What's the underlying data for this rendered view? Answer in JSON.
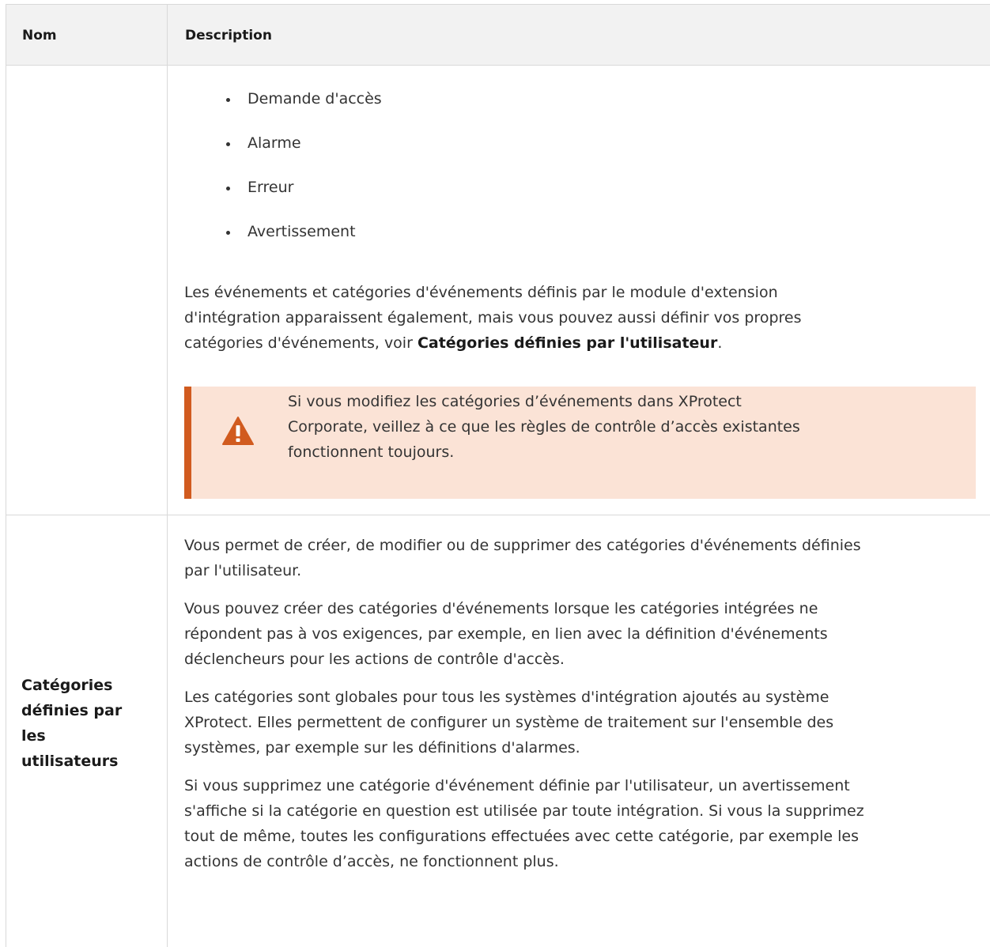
{
  "table": {
    "headers": {
      "name": "Nom",
      "description": "Description"
    },
    "row1": {
      "bullets": [
        "Demande d'accès",
        "Alarme",
        "Erreur",
        "Avertissement"
      ],
      "paragraph_part1": "Les événements et catégories d'événements définis par le module d'extension",
      "paragraph_part2": "d'intégration apparaissent également, mais vous pouvez aussi définir vos propres",
      "paragraph_part3": "catégories d'événements, voir ",
      "paragraph_link": "Catégories définies par l'utilisateur",
      "paragraph_end": ".",
      "warning": {
        "icon": "warning-triangle-icon",
        "line1": "Si vous modifiez les catégories d’événements dans XProtect",
        "line2": "Corporate, veillez à ce que les règles de contrôle d’accès existantes",
        "line3": "fonctionnent toujours.",
        "accent_color": "#d15b1f",
        "background_color": "#fbe3d6"
      }
    },
    "row2": {
      "name_lines": [
        "Catégories",
        "définies par",
        "les",
        "utilisateurs"
      ],
      "paragraphs": [
        [
          "Vous permet de créer, de modifier ou de supprimer des catégories d'événements définies",
          "par l'utilisateur."
        ],
        [
          "Vous pouvez créer des catégories d'événements lorsque les catégories intégrées ne",
          "répondent pas à vos exigences, par exemple, en lien avec la définition d'événements",
          "déclencheurs pour les actions de contrôle d'accès."
        ],
        [
          "Les catégories sont globales pour tous les systèmes d'intégration ajoutés au système",
          "XProtect. Elles permettent de configurer un système de traitement sur l'ensemble des",
          "systèmes, par exemple sur les définitions d'alarmes."
        ],
        [
          "Si vous supprimez une catégorie d'événement définie par l'utilisateur, un avertissement",
          "s'affiche si la catégorie en question est utilisée par toute intégration. Si vous la supprimez",
          "tout de même, toutes les configurations effectuées avec cette catégorie, par exemple les",
          "actions de contrôle d’accès, ne fonctionnent plus."
        ]
      ]
    }
  }
}
